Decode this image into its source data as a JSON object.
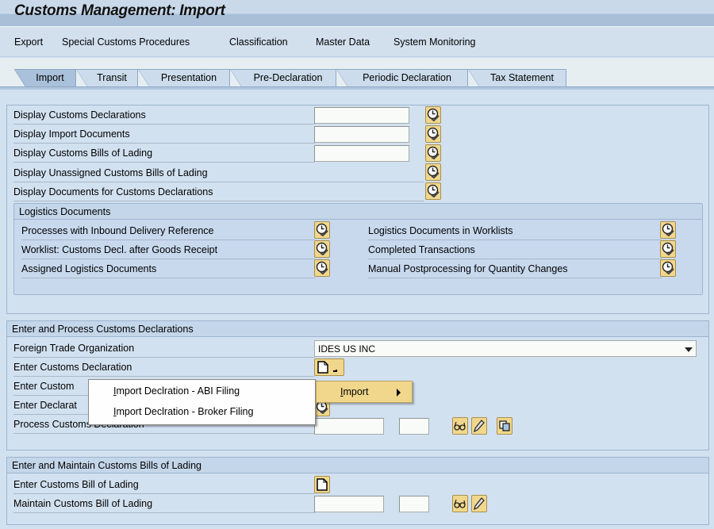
{
  "window": {
    "title": "Customs Management: Import"
  },
  "menu": [
    "Export",
    "Special Customs Procedures",
    "Classification",
    "Master Data",
    "System Monitoring"
  ],
  "tabs": [
    {
      "label": "Import",
      "active": true
    },
    {
      "label": "Transit",
      "active": false
    },
    {
      "label": "Presentation",
      "active": false
    },
    {
      "label": "Pre-Declaration",
      "active": false
    },
    {
      "label": "Periodic Declaration",
      "active": false
    },
    {
      "label": "Tax Statement",
      "active": false
    }
  ],
  "display_section": {
    "rows": [
      {
        "label": "Display Customs Declarations",
        "input_value": "",
        "action_icon": "execute-clock-icon"
      },
      {
        "label": "Display Import Documents",
        "input_value": "",
        "action_icon": "execute-clock-icon"
      },
      {
        "label": "Display Customs Bills of Lading",
        "input_value": "",
        "action_icon": "execute-clock-icon"
      },
      {
        "label": "Display Unassigned Customs Bills of Lading",
        "action_icon": "execute-clock-icon"
      },
      {
        "label": "Display Documents for Customs Declarations",
        "action_icon": "execute-clock-icon"
      }
    ],
    "logistics": {
      "header": "Logistics Documents",
      "left": [
        "Processes with Inbound Delivery Reference",
        "Worklist: Customs Decl. after Goods Receipt",
        "Assigned Logistics Documents"
      ],
      "right": [
        "Logistics Documents in Worklists",
        "Completed Transactions",
        "Manual Postprocessing for Quantity Changes"
      ]
    }
  },
  "declarations_section": {
    "header": "Enter and Process Customs Declarations",
    "foreign_trade_org_label": "Foreign Trade Organization",
    "foreign_trade_org_value": "IDES US INC",
    "enter_decl_label": "Enter Customs Declaration",
    "row3_label_visible": "Enter Custom",
    "row4_label_visible": "Enter Declarat",
    "process_label": "Process Customs Declaration",
    "process_input_value": "",
    "process_input2_value": ""
  },
  "context_menu": {
    "parent": {
      "mnemonic": "I",
      "rest": "mport"
    },
    "items": [
      {
        "mnemonic": "I",
        "rest": "mport Declration - ABI  Filing"
      },
      {
        "mnemonic": "I",
        "rest": "mport Declration - Broker Filing"
      }
    ]
  },
  "bills_section": {
    "header": "Enter and Maintain Customs Bills of Lading",
    "enter_label": "Enter Customs Bill of Lading",
    "maintain_label": "Maintain Customs Bill of Lading",
    "maintain_input_value": "",
    "maintain_input2_value": ""
  },
  "colors": {
    "background": "#d2e1f0",
    "button_yellow": "#f1d78c",
    "active_tab": "#a9c1da",
    "header_band": "#a9bfd7"
  }
}
